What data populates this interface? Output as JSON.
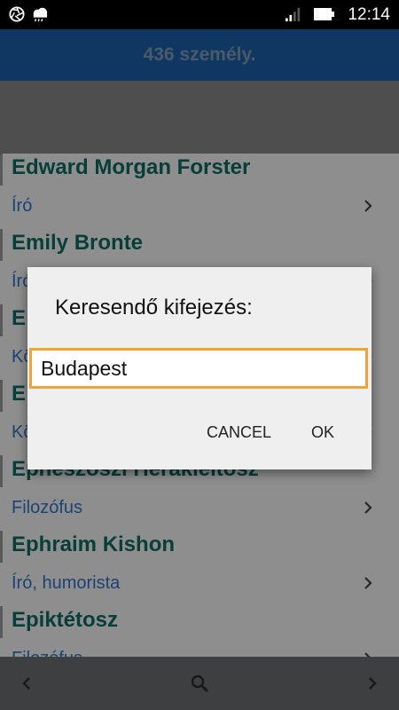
{
  "status_bar": {
    "left_icons": [
      "aperture-icon",
      "weather-cloud-icon"
    ],
    "right_icons": [
      "signal-icon",
      "battery-icon"
    ],
    "time": "12:14"
  },
  "header": {
    "title": "436 személy."
  },
  "people": [
    {
      "name": "Edward Morgan Forster",
      "role": "Író"
    },
    {
      "name": "Emily Bronte",
      "role": "Író"
    },
    {
      "name": "E",
      "role": "Kö"
    },
    {
      "name": "E",
      "role": "Kö"
    },
    {
      "name": "Epheszoszi Hérakleitosz",
      "role": "Filozófus"
    },
    {
      "name": "Ephraim Kishon",
      "role": "Író, humorista"
    },
    {
      "name": "Epiktétosz",
      "role": "Filozófus"
    }
  ],
  "bottom_bar": {
    "icons": [
      "chevron-left-icon",
      "search-icon",
      "chevron-right-icon"
    ]
  },
  "dialog": {
    "title": "Keresendő kifejezés:",
    "input_value": "Budapest",
    "cancel_label": "CANCEL",
    "ok_label": "OK"
  },
  "colors": {
    "header_bg": "#1d5fa8",
    "name_color": "#0e6b63",
    "role_color": "#2f74c8",
    "input_focus": "#f2a23a"
  }
}
